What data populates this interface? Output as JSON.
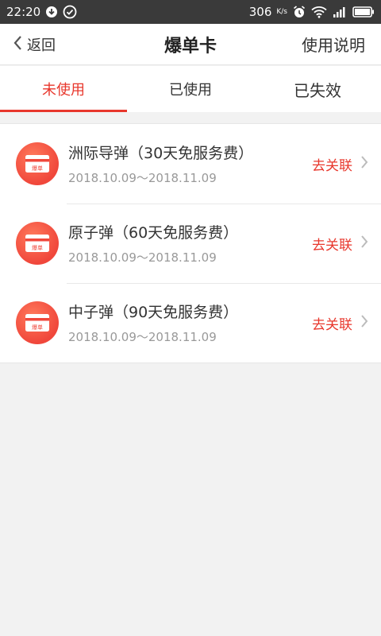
{
  "status_bar": {
    "time": "22:20",
    "speed": "306",
    "speed_unit": "K/s",
    "icons": [
      "download-icon",
      "check-circle-icon",
      "alarm-icon",
      "wifi-icon",
      "signal-4g-icon",
      "battery-icon"
    ]
  },
  "navbar": {
    "back_label": "返回",
    "title": "爆单卡",
    "right_label": "使用说明"
  },
  "tabs": [
    {
      "label": "未使用",
      "active": true
    },
    {
      "label": "已使用",
      "active": false
    },
    {
      "label": "已失效",
      "active": false
    }
  ],
  "cards": [
    {
      "title": "洲际导弹（30天免服务费）",
      "date_range": "2018.10.09～2018.11.09",
      "action": "去关联"
    },
    {
      "title": "原子弹（60天免服务费）",
      "date_range": "2018.10.09～2018.11.09",
      "action": "去关联"
    },
    {
      "title": "中子弹（90天免服务费）",
      "date_range": "2018.10.09～2018.11.09",
      "action": "去关联"
    }
  ],
  "card_icon_text": "爆单",
  "colors": {
    "accent": "#e8372c",
    "status_bar": "#3a3a3a",
    "background": "#f2f2f2"
  }
}
